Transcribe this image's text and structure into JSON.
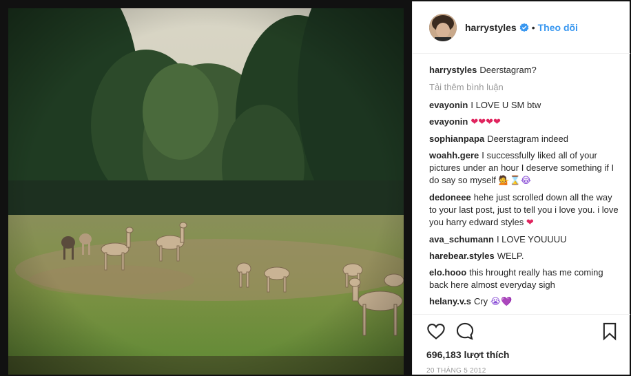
{
  "post": {
    "username": "harrystyles",
    "follow_label": "Theo dõi",
    "separator": "•",
    "caption_user": "harrystyles",
    "caption_text": "Deerstagram?",
    "load_more": "Tải thêm bình luận",
    "likes": "696,183 lượt thích",
    "date": "20 THÁNG 5 2012"
  },
  "comments": [
    {
      "user": "evayonin",
      "text": "I LOVE U SM btw"
    },
    {
      "user": "evayonin",
      "text": "",
      "emoji": "❤❤❤❤"
    },
    {
      "user": "sophianpapa",
      "text": "Deerstagram indeed"
    },
    {
      "user": "woahh.gere",
      "text": "I successfully liked all of your pictures under an hour I deserve something if I do say so myself",
      "emoji": "💁⌛😂"
    },
    {
      "user": "dedoneee",
      "text": "hehe just scrolled down all the way to your last post, just to tell you i love you. i love you harry edward styles",
      "emoji": "❤"
    },
    {
      "user": "ava_schumann",
      "text": "I LOVE YOUUUU"
    },
    {
      "user": "harebear.styles",
      "text": "WELP."
    },
    {
      "user": "elo.hooo",
      "text": "this hrought really has me coming back here almost everyday sigh"
    },
    {
      "user": "helany.v.s",
      "text": "Cry",
      "emoji": "😭💜"
    }
  ],
  "icons": {
    "verified": "verified-badge-icon",
    "like": "heart-icon",
    "comment": "speech-bubble-icon",
    "save": "bookmark-icon"
  },
  "colors": {
    "link_blue": "#3897f0",
    "heart_red": "#e0245e"
  }
}
